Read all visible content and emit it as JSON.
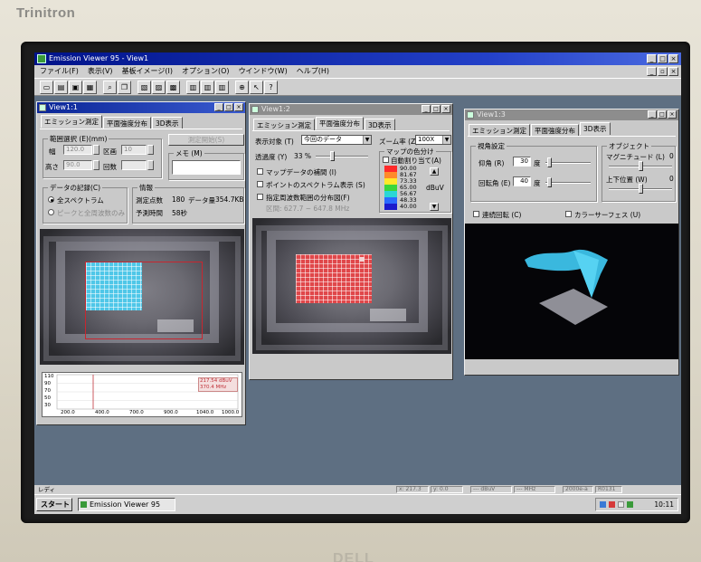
{
  "monitor": {
    "brand": "Trinitron",
    "maker": "DELL"
  },
  "app": {
    "title": "Emission Viewer 95 - View1",
    "menu": [
      "ファイル(F)",
      "表示(V)",
      "基板イメージ(I)",
      "オプション(O)",
      "ウインドウ(W)",
      "ヘルプ(H)"
    ]
  },
  "toolbar_icons": [
    "new-icon",
    "open-icon",
    "save-icon",
    "print-icon",
    "zoom-icon",
    "copy-icon",
    "view-icon",
    "view-icon",
    "view-icon",
    "tile-icon",
    "tile-icon",
    "tile-icon",
    "zoom-in-icon",
    "pointer-icon",
    "help-icon"
  ],
  "view1": {
    "title": "View1:1",
    "tabs": [
      "エミッション測定",
      "平面強度分布",
      "3D表示"
    ],
    "range_group": "範囲選択 (E)(mm)",
    "width_label": "幅",
    "width_value": "120.0",
    "height_label": "高さ",
    "height_value": "90.0",
    "div_label": "区画",
    "div_value": "10",
    "count_label": "回数",
    "measure_btn": "測定開始(S)",
    "memo_label": "メモ (M)",
    "record_group": "データの記録(C)",
    "opt_all": "全スペクトラム",
    "opt_peak": "ピークと全周波数のみ",
    "info_group": "情報",
    "points_label": "測定点数",
    "points_value": "180",
    "data_label": "データ量",
    "data_value": "354.7KB",
    "time_label": "予測時間",
    "time_value": "58秒",
    "spec_y": [
      "110",
      "90",
      "70",
      "50",
      "30"
    ],
    "spec_x": [
      "200.0",
      "400.0",
      "700.0",
      "900.0",
      "1040.0",
      "1000.0"
    ],
    "spec_readout_1": "217.54 dBuV",
    "spec_readout_2": "370.4 MHz"
  },
  "view2": {
    "title": "View1:2",
    "tabs": [
      "エミッション測定",
      "平面強度分布",
      "3D表示"
    ],
    "target_label": "表示対象 (T)",
    "target_value": "今回のデータ",
    "zoom_label": "ズーム率 (Z)",
    "zoom_value": "100X",
    "transparency_label": "透過度 (Y)",
    "transparency_value": "33 %",
    "map_color_group": "マップの色分け",
    "auto_alloc": "自動割り当て(A)",
    "chk_interp": "マップデータの補間 (I)",
    "chk_point_spec": "ポイントのスペクトラム表示 (S)",
    "chk_range": "指定周波数範囲の分布図(F)",
    "range_text": "区間: 627.7 ~ 647.8 MHz",
    "unit": "dBuV",
    "legend": [
      "90.00",
      "81.67",
      "73.33",
      "65.00",
      "56.67",
      "48.33",
      "40.00"
    ],
    "legend_colors": [
      "#ff2a2a",
      "#ff8a2a",
      "#ffe82a",
      "#3ad63a",
      "#2ad6d6",
      "#2a6aff",
      "#1a1acc"
    ]
  },
  "view3": {
    "title": "View1:3",
    "tabs": [
      "エミッション測定",
      "平面強度分布",
      "3D表示"
    ],
    "view_group": "視角設定",
    "elev_label": "仰角 (R)",
    "elev_value": "30",
    "elev_unit": "度",
    "rot_label": "回転角 (E)",
    "rot_value": "40",
    "rot_unit": "度",
    "object_group": "オブジェクト",
    "mag_label": "マグニチュード (L)",
    "mag_value": "0",
    "updown_label": "上下位置 (W)",
    "updown_value": "0",
    "chk_cont_rot": "連続回転 (C)",
    "chk_color_surface": "カラーサーフェス (U)"
  },
  "status": {
    "ready": "レディ",
    "x": "x: 217.3",
    "y": "y: 0.0",
    "dbuv": "--- dBuV",
    "mhz": "--- MHz",
    "time": "2000e-a",
    "code": "R0131"
  },
  "taskbar": {
    "start": "スタート",
    "item": "Emission Viewer 95",
    "clock": "10:11"
  }
}
